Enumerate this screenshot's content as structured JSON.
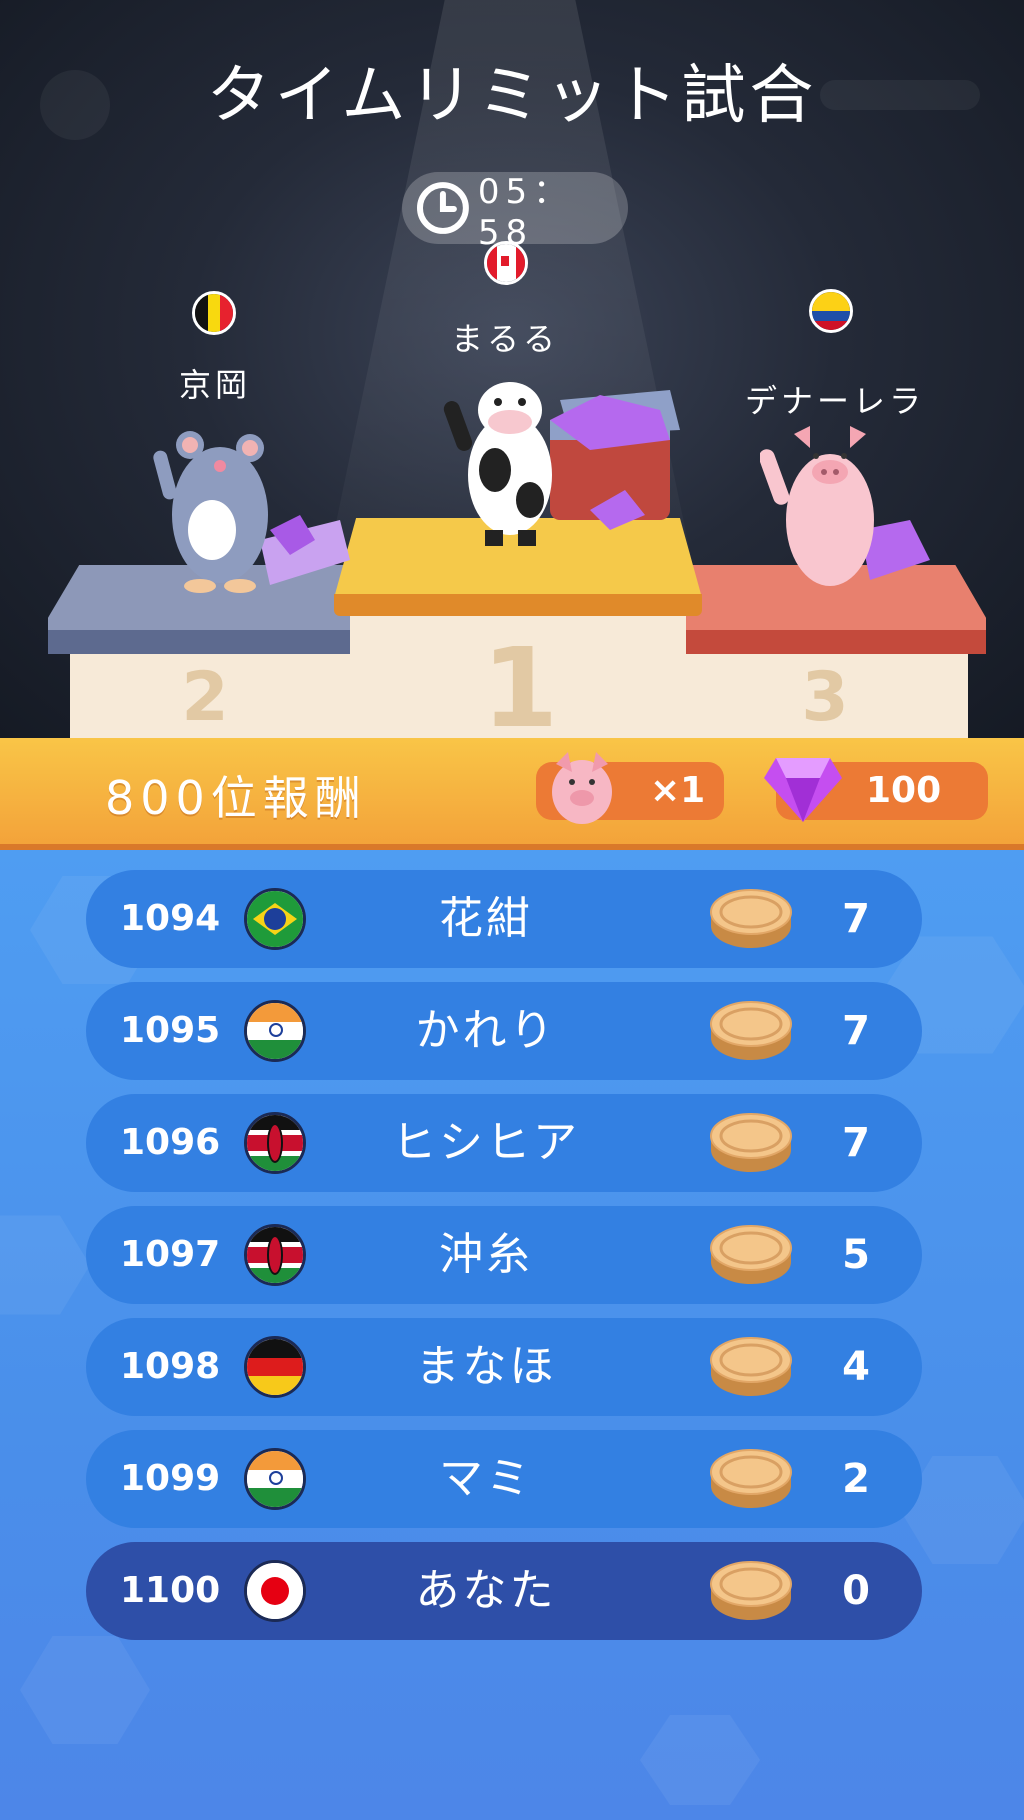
{
  "header": {
    "title": "タイムリミット試合",
    "timer": "05：58"
  },
  "podium": [
    {
      "place_label": "2",
      "name": "京岡",
      "country": "Belgium",
      "animal": "mouse"
    },
    {
      "place_label": "1",
      "name": "まるる",
      "country": "Canada",
      "animal": "cow"
    },
    {
      "place_label": "3",
      "name": "デナーレラ",
      "country": "Colombia",
      "animal": "pig"
    }
  ],
  "reward": {
    "label": "800位報酬",
    "pig_count": "×1",
    "gem_count": "100"
  },
  "leaderboard": [
    {
      "rank": "1094",
      "country": "Brazil",
      "name": "花紺",
      "score": "7"
    },
    {
      "rank": "1095",
      "country": "India",
      "name": "かれり",
      "score": "7"
    },
    {
      "rank": "1096",
      "country": "Kenya",
      "name": "ヒシヒア",
      "score": "7"
    },
    {
      "rank": "1097",
      "country": "Kenya",
      "name": "沖糸",
      "score": "5"
    },
    {
      "rank": "1098",
      "country": "Germany",
      "name": "まなほ",
      "score": "4"
    },
    {
      "rank": "1099",
      "country": "India",
      "name": "マミ",
      "score": "2"
    },
    {
      "rank": "1100",
      "country": "Japan",
      "name": "あなた",
      "score": "0",
      "is_self": true
    }
  ],
  "colors": {
    "row": "#3380e2",
    "row_self": "#2e4fa8",
    "reward_bar": "#f3a33a",
    "pill": "#ec7a35"
  }
}
